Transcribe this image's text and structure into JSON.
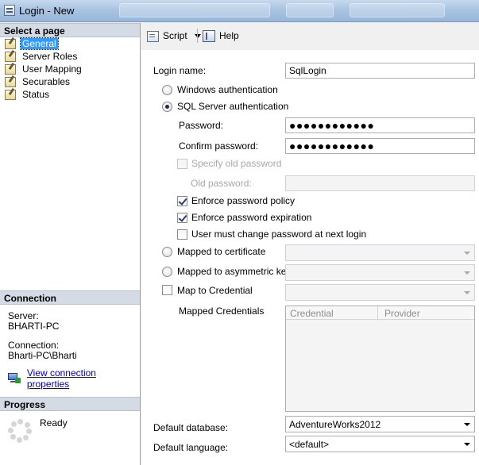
{
  "window": {
    "title": "Login - New"
  },
  "left": {
    "select_page_header": "Select a page",
    "pages": [
      {
        "label": "General",
        "selected": true
      },
      {
        "label": "Server Roles",
        "selected": false
      },
      {
        "label": "User Mapping",
        "selected": false
      },
      {
        "label": "Securables",
        "selected": false
      },
      {
        "label": "Status",
        "selected": false
      }
    ],
    "connection_header": "Connection",
    "server_label": "Server:",
    "server_value": "BHARTI-PC",
    "connection_label": "Connection:",
    "connection_value": "Bharti-PC\\Bharti",
    "view_connection_link": "View connection properties",
    "progress_header": "Progress",
    "progress_status": "Ready"
  },
  "toolbar": {
    "script_label": "Script",
    "help_label": "Help"
  },
  "form": {
    "login_name_label": "Login name:",
    "login_name_value": "SqlLogin",
    "windows_auth_label": "Windows authentication",
    "sql_auth_label": "SQL Server authentication",
    "auth_mode": "sql",
    "password_label": "Password:",
    "password_value": "●●●●●●●●●●●●",
    "confirm_password_label": "Confirm password:",
    "confirm_password_value": "●●●●●●●●●●●●",
    "specify_old_password_label": "Specify old password",
    "old_password_label": "Old password:",
    "old_password_value": "",
    "enforce_policy_label": "Enforce password policy",
    "enforce_policy_checked": true,
    "enforce_expiration_label": "Enforce password expiration",
    "enforce_expiration_checked": true,
    "must_change_label": "User must change password at next login",
    "must_change_checked": false,
    "mapped_cert_label": "Mapped to certificate",
    "mapped_cert_value": "",
    "mapped_asym_label": "Mapped to asymmetric key",
    "mapped_asym_value": "",
    "map_credential_label": "Map to Credential",
    "map_credential_value": "",
    "mapped_credentials_label": "Mapped Credentials",
    "cred_columns": [
      "Credential",
      "Provider"
    ],
    "default_db_label": "Default database:",
    "default_db_value": "AdventureWorks2012",
    "default_lang_label": "Default language:",
    "default_lang_value": "<default>"
  }
}
